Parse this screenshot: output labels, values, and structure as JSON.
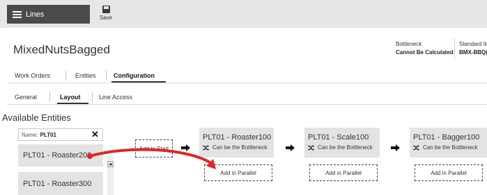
{
  "header": {
    "lines_label": "Lines",
    "save_label": "Save"
  },
  "page": {
    "title": "MixedNutsBagged"
  },
  "stats": {
    "bottleneck_label": "Bottleneck",
    "bottleneck_value": "Cannot Be Calculated",
    "standard_item_label": "Standard Ite",
    "standard_item_value": "BMX-BBQ(E"
  },
  "main_tabs": [
    {
      "label": "Work Orders"
    },
    {
      "label": "Entities"
    },
    {
      "label": "Configuration",
      "active": true
    }
  ],
  "sub_tabs": [
    {
      "label": "General"
    },
    {
      "label": "Layout",
      "active": true
    },
    {
      "label": "Line Access"
    }
  ],
  "available": {
    "title": "Available Entities",
    "filter_label": "Name:",
    "filter_value": "PLT01",
    "clear_glyph": "✕",
    "entities": [
      "PLT01 - Roaster200",
      "PLT01 - Roaster300"
    ]
  },
  "layout": {
    "add_to_start": "Add to Start",
    "add_in_parallel": "Add in Parallel",
    "nodes": [
      {
        "title": "PLT01 - Roaster100",
        "subtitle": "Can be the Bottleneck"
      },
      {
        "title": "PLT01 - Scale100",
        "subtitle": "Can be the Bottleneck"
      },
      {
        "title": "PLT01 - Bagger100",
        "subtitle": "Can be the Bottleneck"
      }
    ]
  },
  "colors": {
    "annotation_arrow": "#e02626",
    "topbar": "#e6e6e6",
    "lines_button": "#4a4a4a",
    "card": "#e3e3e3"
  },
  "icons": {
    "lines_button": "hamburger-icon",
    "save": "save-disk-icon",
    "flow_arrow": "arrow-right-icon",
    "bottleneck": "shuffle-icon",
    "scroll": "triangle-up-icon"
  }
}
